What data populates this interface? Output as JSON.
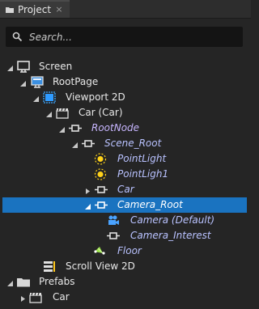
{
  "tab": {
    "label": "Project",
    "close": "×"
  },
  "search": {
    "placeholder": "Search..."
  },
  "tree": [
    {
      "label": "Screen"
    },
    {
      "label": "RootPage"
    },
    {
      "label": "Viewport 2D"
    },
    {
      "label": "Car (Car)"
    },
    {
      "label": "RootNode"
    },
    {
      "label": "Scene_Root"
    },
    {
      "label": "PointLight"
    },
    {
      "label": "PointLigh1"
    },
    {
      "label": "Car"
    },
    {
      "label": "Camera_Root"
    },
    {
      "label": "Camera (Default)"
    },
    {
      "label": "Camera_Interest"
    },
    {
      "label": "Floor"
    },
    {
      "label": "Scroll View 2D"
    },
    {
      "label": "Prefabs"
    },
    {
      "label": "Car"
    }
  ],
  "colors": {
    "selection": "#1a73c0",
    "light_yellow": "#ffd21a",
    "node_blue": "#4aa3ff"
  }
}
